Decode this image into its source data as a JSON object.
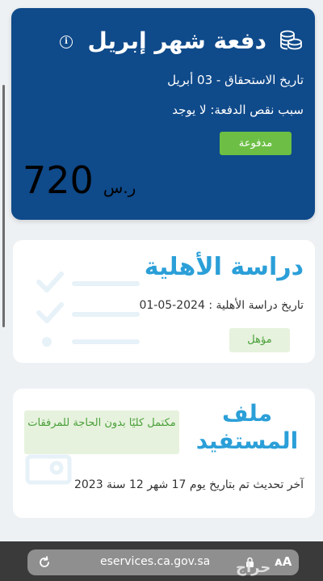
{
  "payment": {
    "title": "دفعة شهر إبريل",
    "due_line": "تاريخ الاستحقاق - 03 أبريل",
    "reason_line": "سبب نقص الدفعة: لا يوجد",
    "status": "مدفوعة",
    "amount": "720",
    "currency": "ر.س",
    "icon": "coins-icon",
    "color": "#0f4a8a"
  },
  "eligibility": {
    "title": "دراسة الأهلية",
    "date_line": "تاريخ دراسة الأهلية : 2024-05-01",
    "status": "مؤهل",
    "title_color": "#2b9fd8"
  },
  "profile": {
    "title": "ملف المستفيد",
    "status": "مكتمل كليًا بدون الحاجة للمرفقات",
    "update_line": "آخر تحديث تم بتاريخ يوم 17 شهر 12 سنة 2023"
  },
  "browser": {
    "url": "eservices.ca.gov.sa",
    "text_size_label": "ᴀA"
  },
  "overlay": {
    "watermark": "حراج"
  }
}
